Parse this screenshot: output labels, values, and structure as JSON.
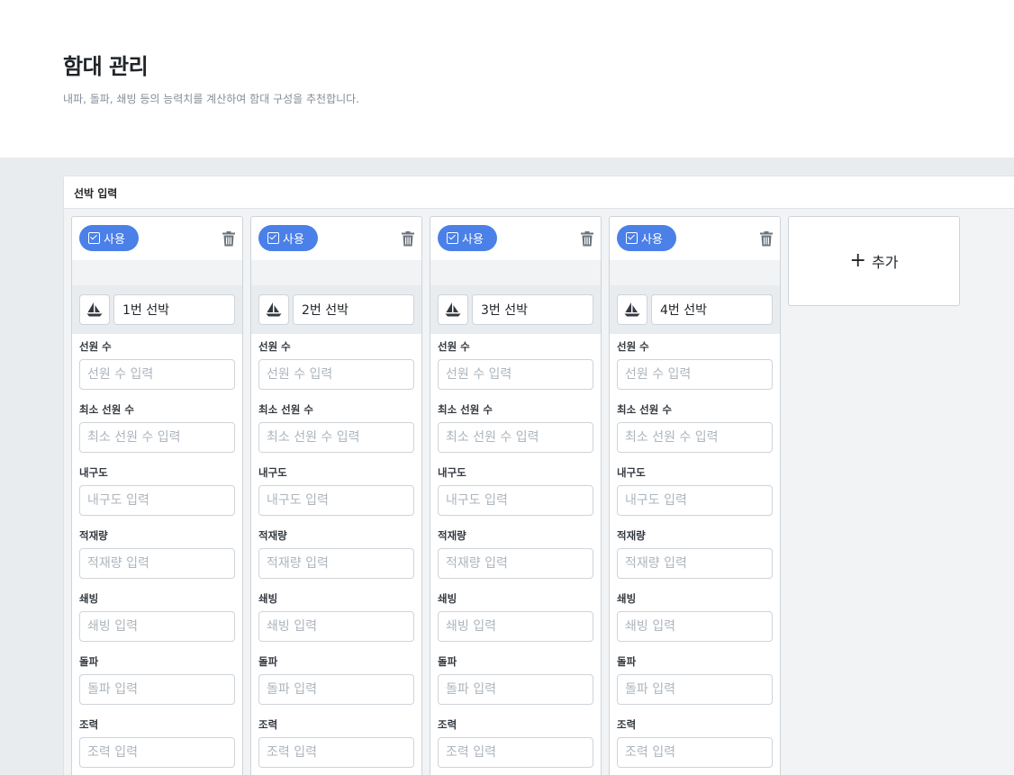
{
  "header": {
    "title": "함대 관리",
    "subtitle": "내파, 돌파, 쇄빙 등의 능력치를 계산하여 함대 구성을 추천합니다."
  },
  "panel": {
    "title": "선박 입력"
  },
  "card_common": {
    "use_label": "사용",
    "fields": [
      {
        "label": "선원 수",
        "placeholder": "선원 수 입력"
      },
      {
        "label": "최소 선원 수",
        "placeholder": "최소 선원 수 입력"
      },
      {
        "label": "내구도",
        "placeholder": "내구도 입력"
      },
      {
        "label": "적재량",
        "placeholder": "적재량 입력"
      },
      {
        "label": "쇄빙",
        "placeholder": "쇄빙 입력"
      },
      {
        "label": "돌파",
        "placeholder": "돌파 입력"
      },
      {
        "label": "조력",
        "placeholder": "조력 입력"
      }
    ]
  },
  "ships": [
    {
      "name": "1번 선박"
    },
    {
      "name": "2번 선박"
    },
    {
      "name": "3번 선박"
    },
    {
      "name": "4번 선박"
    }
  ],
  "add_button": {
    "label": "추가"
  },
  "icons": {
    "use": "checkbox-icon",
    "delete": "trash-icon",
    "ship": "sailboat-icon",
    "add": "plus-icon"
  },
  "colors": {
    "accent": "#4a80e8",
    "background": "#e9ecef"
  }
}
